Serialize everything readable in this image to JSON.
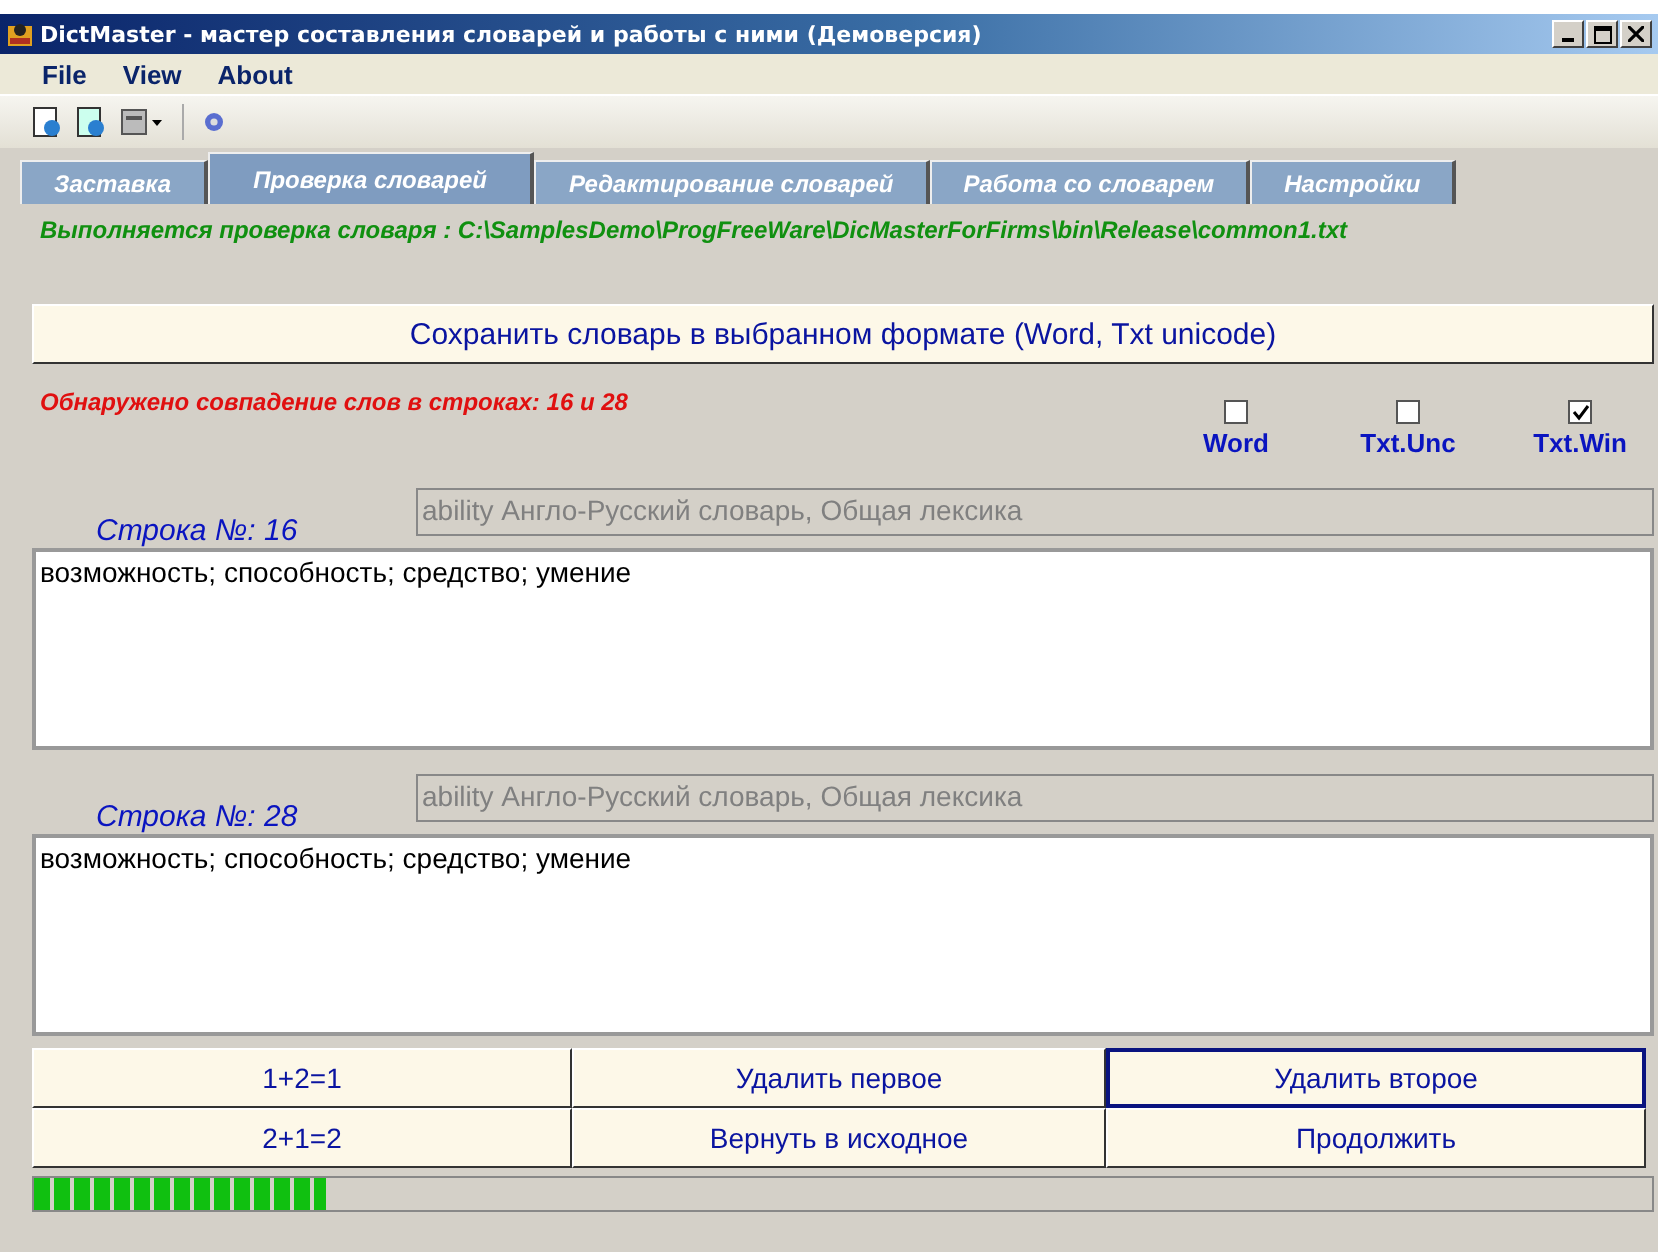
{
  "window": {
    "title": "DictMaster - мастер составления словарей и работы с ними (Демоверсия)"
  },
  "menu": [
    "File",
    "View",
    "About"
  ],
  "tabs": [
    {
      "label": "Заставка",
      "selected": false
    },
    {
      "label": "Проверка словарей",
      "selected": true
    },
    {
      "label": "Редактирование словарей",
      "selected": false
    },
    {
      "label": "Работа со словарем",
      "selected": false
    },
    {
      "label": "Настройки",
      "selected": false
    }
  ],
  "status_line": "Выполняется проверка словаря : C:\\SamplesDemo\\ProgFreeWare\\DicMasterForFirms\\bin\\Release\\common1.txt",
  "save_button": "Сохранить словарь в выбранном формате (Word, Txt unicode)",
  "match_message": "Обнаружено совпадение слов в строках: 16 и 28",
  "formats": [
    {
      "label": "Word",
      "checked": false
    },
    {
      "label": "Txt.Unc",
      "checked": false
    },
    {
      "label": "Txt.Win",
      "checked": true
    }
  ],
  "entries": [
    {
      "label": "Строка №: 16",
      "header": "ability  Англо-Русский словарь, Общая лексика",
      "text": "возможность; способность; средство;  умение"
    },
    {
      "label": "Строка №: 28",
      "header": "ability  Англо-Русский словарь, Общая лексика",
      "text": "возможность; способность; средство;  умение"
    }
  ],
  "buttons": [
    {
      "label": "1+2=1",
      "focused": false
    },
    {
      "label": "Удалить первое",
      "focused": false
    },
    {
      "label": "Удалить второе",
      "focused": true
    },
    {
      "label": "2+1=2",
      "focused": false
    },
    {
      "label": "Вернуть в исходное",
      "focused": false
    },
    {
      "label": "Продолжить",
      "focused": false
    }
  ],
  "progress": {
    "level": 0.18
  }
}
